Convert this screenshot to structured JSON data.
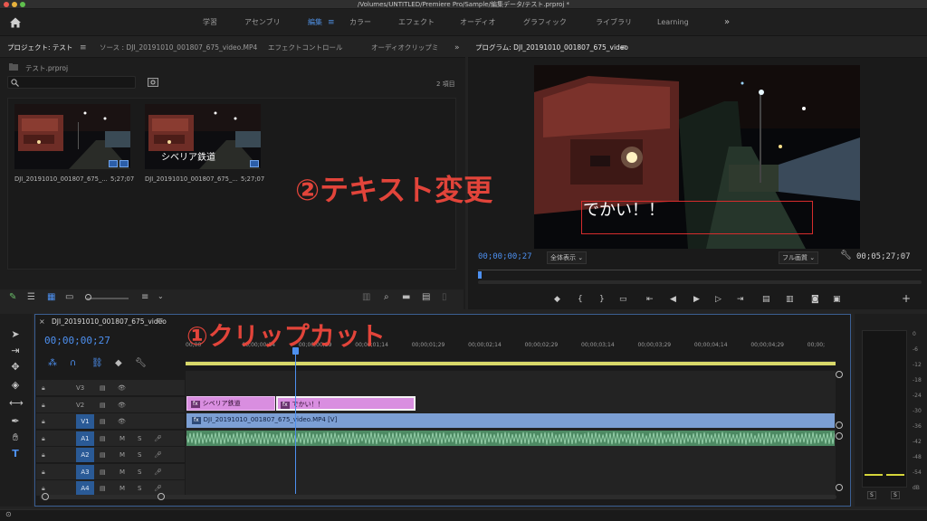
{
  "window": {
    "title": "/Volumes/UNTITLED/Premiere Pro/Sample/編集データ/テスト.prproj *"
  },
  "workspaces": {
    "items": [
      "学習",
      "アセンブリ",
      "編集",
      "カラー",
      "エフェクト",
      "オーディオ",
      "グラフィック",
      "ライブラリ",
      "Learning"
    ],
    "active": "編集",
    "more": "»"
  },
  "project_panel": {
    "tabs": [
      "プロジェクト: テスト",
      "ソース : DJI_20191010_001807_675_video.MP4",
      "エフェクトコントロール",
      "オーディオクリップミ"
    ],
    "more": "»",
    "file": "テスト.prproj",
    "search_placeholder": "",
    "item_count": "2 項目",
    "items": [
      {
        "name": "DJI_20191010_001807_675_...",
        "duration": "5;27;07",
        "overlay_text": ""
      },
      {
        "name": "DJI_20191010_001807_675_...",
        "duration": "5;27;07",
        "overlay_text": "シベリア鉄道"
      }
    ]
  },
  "program_monitor": {
    "title": "プログラム: DJI_20191010_001807_675_video",
    "current_timecode": "00;00;00;27",
    "zoom": "全体表示",
    "quality": "フル画質",
    "duration": "00;05;27;07",
    "caption_text": "でかい！！"
  },
  "timeline": {
    "sequence_name": "DJI_20191010_001807_675_video",
    "timecode": "00;00;00;27",
    "ruler": [
      "00;00",
      "00;00;00;14",
      "00;00;00;29",
      "00;00;01;14",
      "00;00;01;29",
      "00;00;02;14",
      "00;00;02;29",
      "00;00;03;14",
      "00;00;03;29",
      "00;00;04;14",
      "00;00;04;29",
      "00;00;"
    ],
    "tracks": [
      {
        "id": "V3",
        "m": "",
        "s": ""
      },
      {
        "id": "V2",
        "m": "",
        "s": ""
      },
      {
        "id": "V1",
        "m": "",
        "s": ""
      },
      {
        "id": "A1",
        "m": "M",
        "s": "S"
      },
      {
        "id": "A2",
        "m": "M",
        "s": "S"
      },
      {
        "id": "A3",
        "m": "M",
        "s": "S"
      },
      {
        "id": "A4",
        "m": "M",
        "s": "S"
      }
    ],
    "clips": {
      "v2_clip_1": "シベリア鉄道",
      "v2_clip_2": "でかい！！",
      "v1_clip": "DJI_20191010_001807_675_video.MP4 [V]"
    },
    "fx_badge": "fx"
  },
  "audio_meter": {
    "scale": [
      "0",
      "-6",
      "-12",
      "-18",
      "-24",
      "-30",
      "-36",
      "-42",
      "-48",
      "-54",
      "dB"
    ],
    "solo_left": "S",
    "solo_right": "S"
  },
  "annotations": {
    "step1": "①クリップカット",
    "step2": "②テキスト変更"
  },
  "colors": {
    "accent_blue": "#4d90f0",
    "annotation_red": "#e2443a",
    "clip_pink": "#d98ee0",
    "clip_blue": "#7c9fd4",
    "audio_green": "#4d8a63"
  }
}
